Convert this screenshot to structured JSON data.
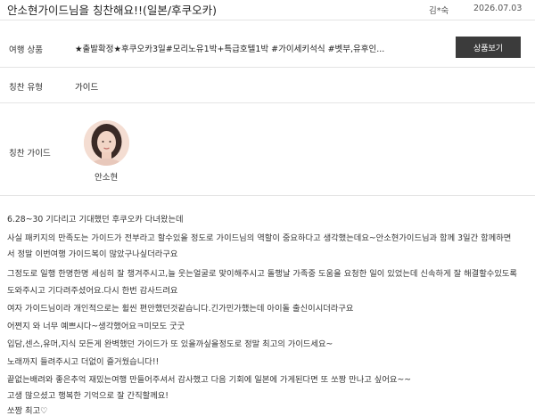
{
  "header": {
    "title": "안소현가이드님을 칭찬해요!!(일본/후쿠오카)",
    "author": "김*숙",
    "date": "2026.07.03"
  },
  "info": {
    "product_label": "여행 상품",
    "product_value": "★출발확정★후쿠오카3일#모리노유1박+특급호텔1박 #가이세키석식 #벳부,유후인...",
    "product_button": "상품보기",
    "type_label": "칭찬 유형",
    "type_value": "가이드",
    "guide_label": "칭찬 가이드",
    "guide_name": "안소현"
  },
  "review": {
    "lines": [
      "6.28~30 기다리고 기대했던 후쿠오카 다녀왔는데",
      "사실 패키지의 만족도는 가이드가 전부라고 할수있을 정도로 가이드님의 역할이 중요하다고 생각했는데요~안소현가이드님과 함께 3일간 함께하면",
      "서 정말 이번여행 가이드복이 많았구나싶더라구요",
      "그정도로 일행 한명한명 세심히 잘 챙겨주시고,늘 웃는얼굴로 맞이해주시고 돌행날 가족중 도움을 요청한 일이 있었는데 신속하게 잘 해결할수있도록",
      "도와주시고 기다려주셨어요.다시 한번 감사드려요",
      "여자 가이드님이라 개인적으로는 휠씬 편안했던것같습니다.긴가민가했는데 아이돌 출신이시더라구요",
      "어쩐지 와 너무 예쁘시다~생각했어요ㅋ미모도 굿굿",
      "입담,센스,유머,지식 모든게 완벽했던 가이드가 또 있을까싶을정도로 정말 최고의 가이드세요~",
      "노래까지 들려주시고 더없이 즐거웠습니다!!",
      "끝없는배려와 좋은추억 재밌는여행 만들어주셔서 감사했고 다음 기회에 일본에 가게된다면 또 쏘짱 만나고 싶어요~~",
      "고생 많으셨고 행복한 기억으로 잘 간직할께요!",
      "쏘짱 최고♡"
    ]
  }
}
